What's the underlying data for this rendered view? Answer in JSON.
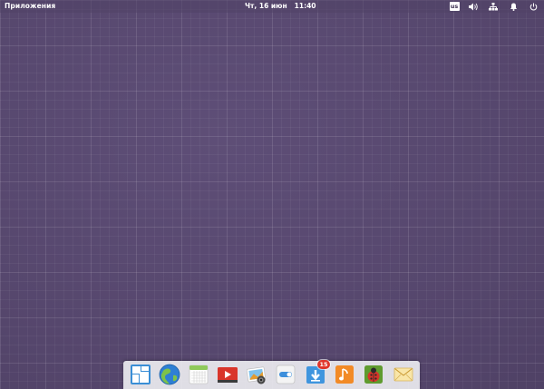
{
  "panel": {
    "applications_label": "Приложения",
    "date": "Чт, 16 июн",
    "time": "11:40",
    "keyboard_layout": "us",
    "tray_icons": [
      "sound-icon",
      "network-icon",
      "notifications-icon",
      "power-icon"
    ]
  },
  "dock": {
    "items": [
      {
        "icon": "multitasking-view-icon"
      },
      {
        "icon": "web-browser-icon"
      },
      {
        "icon": "calendar-icon"
      },
      {
        "icon": "videos-icon"
      },
      {
        "icon": "photos-icon"
      },
      {
        "icon": "system-settings-icon"
      },
      {
        "icon": "appcenter-icon",
        "badge": "15"
      },
      {
        "icon": "music-icon"
      },
      {
        "icon": "bug-app-icon"
      },
      {
        "icon": "mail-icon"
      }
    ]
  },
  "colors": {
    "desktop_background": "#5a4a72",
    "panel_text": "#ffffff",
    "badge": "#e0352b"
  }
}
